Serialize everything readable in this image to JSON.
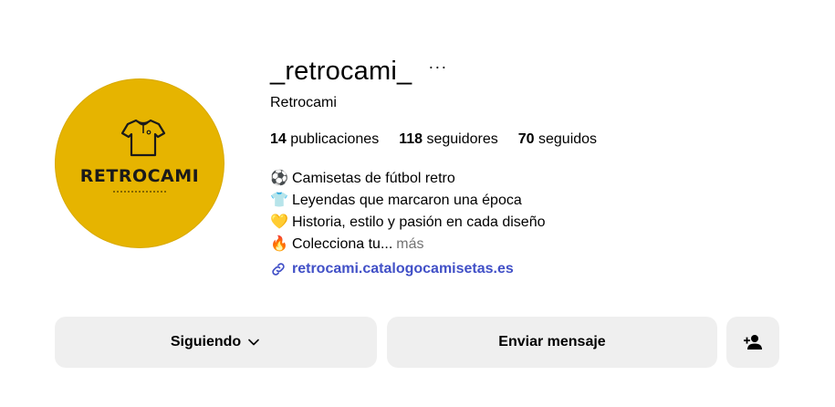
{
  "profile": {
    "username": "_retrocami_",
    "more_icon": "more-dots-icon",
    "full_name": "Retrocami",
    "avatar_brand": "RETROCAMI",
    "stats": [
      {
        "count": "14",
        "label": "publicaciones"
      },
      {
        "count": "118",
        "label": "seguidores"
      },
      {
        "count": "70",
        "label": "seguidos"
      }
    ],
    "bio": [
      {
        "emoji": "⚽",
        "text": "Camisetas de fútbol retro"
      },
      {
        "emoji": "👕",
        "text": "Leyendas que marcaron una época"
      },
      {
        "emoji": "💛",
        "text": "Historia, estilo y pasión en cada diseño"
      },
      {
        "emoji": "🔥",
        "text": "Colecciona tu..."
      }
    ],
    "bio_more": "más",
    "link": "retrocami.catalogocamisetas.es"
  },
  "actions": {
    "following_label": "Siguiendo",
    "message_label": "Enviar mensaje"
  },
  "colors": {
    "avatar_bg": "#e6b400",
    "link": "#4150c7",
    "button_bg": "#efefef",
    "muted": "#737373"
  }
}
